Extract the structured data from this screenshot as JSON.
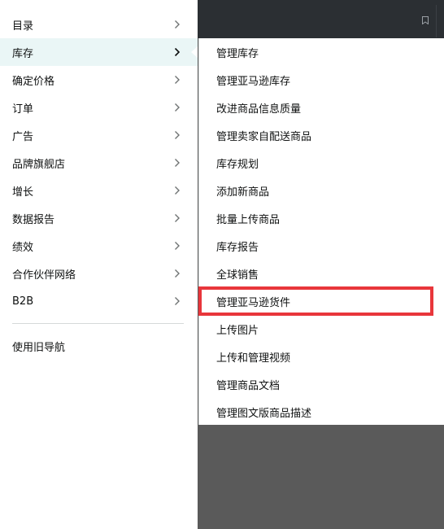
{
  "main_menu": {
    "items": [
      {
        "label": "目录",
        "has_submenu": true,
        "active": false
      },
      {
        "label": "库存",
        "has_submenu": true,
        "active": true
      },
      {
        "label": "确定价格",
        "has_submenu": true,
        "active": false
      },
      {
        "label": "订单",
        "has_submenu": true,
        "active": false
      },
      {
        "label": "广告",
        "has_submenu": true,
        "active": false
      },
      {
        "label": "品牌旗舰店",
        "has_submenu": true,
        "active": false
      },
      {
        "label": "增长",
        "has_submenu": true,
        "active": false
      },
      {
        "label": "数据报告",
        "has_submenu": true,
        "active": false
      },
      {
        "label": "绩效",
        "has_submenu": true,
        "active": false
      },
      {
        "label": "合作伙伴网络",
        "has_submenu": true,
        "active": false
      },
      {
        "label": "B2B",
        "has_submenu": true,
        "active": false
      }
    ],
    "legacy_nav_label": "使用旧导航"
  },
  "inventory_submenu": {
    "items": [
      {
        "label": "管理库存"
      },
      {
        "label": "管理亚马逊库存"
      },
      {
        "label": "改进商品信息质量"
      },
      {
        "label": "管理卖家自配送商品"
      },
      {
        "label": "库存规划"
      },
      {
        "label": "添加新商品"
      },
      {
        "label": "批量上传商品"
      },
      {
        "label": "库存报告"
      },
      {
        "label": "全球销售"
      },
      {
        "label": "管理亚马逊货件",
        "highlighted": true
      },
      {
        "label": "上传图片"
      },
      {
        "label": "上传和管理视频"
      },
      {
        "label": "管理商品文档"
      },
      {
        "label": "管理图文版商品描述"
      }
    ]
  },
  "colors": {
    "topbar": "#2b2f33",
    "overlay": "#5a5a5a",
    "active_item_bg": "#eaf6f6",
    "highlight_border": "#e8363b",
    "text": "#0f1111",
    "chevron": "#6f7373"
  }
}
